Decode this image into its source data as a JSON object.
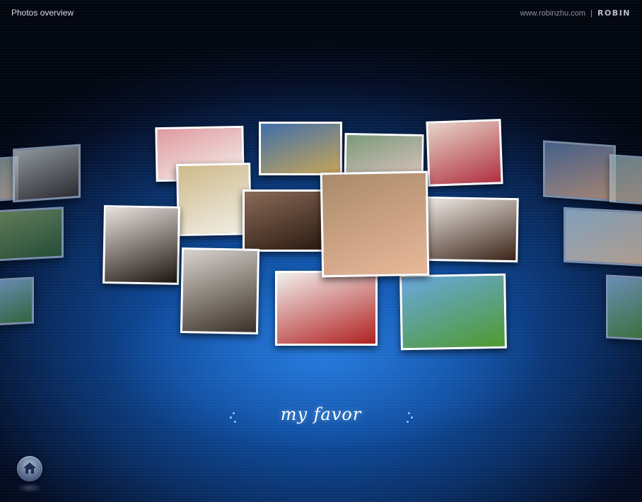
{
  "header": {
    "title": "Photos overview",
    "site_url": "www.robinzhu.com",
    "separator": "|",
    "logo_text": "ROBIN"
  },
  "gallery": {
    "caption": "my favor",
    "photos": [
      {
        "name": "photo-left-woman-edge",
        "subject": "woman portrait",
        "colors": [
          "#8fa3a3",
          "#c9b8a8"
        ]
      },
      {
        "name": "photo-left-woman",
        "subject": "woman portrait",
        "colors": [
          "#bcc7c9",
          "#3a302c"
        ]
      },
      {
        "name": "photo-left-leaves",
        "subject": "green leaves",
        "colors": [
          "#7fa06a",
          "#2f5a2e"
        ]
      },
      {
        "name": "photo-left-tree",
        "subject": "tree on hill",
        "colors": [
          "#8ab0d6",
          "#3f7a3a"
        ]
      },
      {
        "name": "photo-dog-bubble",
        "subject": "dog with bubble",
        "colors": [
          "#e09aa0",
          "#f4f0ec"
        ]
      },
      {
        "name": "photo-sky-field",
        "subject": "sky and field",
        "colors": [
          "#3f6fa8",
          "#c8a55a"
        ]
      },
      {
        "name": "photo-bubblegum-girl",
        "subject": "girl blowing bubble",
        "colors": [
          "#7a9a7a",
          "#e8c8c8"
        ]
      },
      {
        "name": "photo-woman-red-top",
        "subject": "woman portrait",
        "colors": [
          "#e6d3c8",
          "#b03040"
        ]
      },
      {
        "name": "photo-puppy",
        "subject": "bulldog puppy",
        "colors": [
          "#cdb98a",
          "#f3efe6"
        ]
      },
      {
        "name": "photo-curly-hair-woman",
        "subject": "woman with curly hair",
        "colors": [
          "#8a6b58",
          "#2a1a12"
        ]
      },
      {
        "name": "photo-smiling-woman-large",
        "subject": "smiling woman",
        "colors": [
          "#a98a6a",
          "#e8b89a"
        ]
      },
      {
        "name": "photo-brunette-woman",
        "subject": "woman portrait",
        "colors": [
          "#f2ece8",
          "#3a2418"
        ]
      },
      {
        "name": "photo-asian-woman-smile",
        "subject": "smiling woman",
        "colors": [
          "#e9e3df",
          "#1c1410"
        ]
      },
      {
        "name": "photo-young-man",
        "subject": "young man",
        "colors": [
          "#d8d4ce",
          "#3a3028"
        ]
      },
      {
        "name": "photo-fashion-woman",
        "subject": "fashion portrait",
        "colors": [
          "#f2f0ee",
          "#b02020"
        ]
      },
      {
        "name": "photo-green-hill-tree",
        "subject": "tree on green hill",
        "colors": [
          "#6aa8e0",
          "#4f9a2e"
        ]
      },
      {
        "name": "photo-right-couple",
        "subject": "couple",
        "colors": [
          "#5a7aa8",
          "#d8a888"
        ]
      },
      {
        "name": "photo-right-edge",
        "subject": "portrait",
        "colors": [
          "#8aa8b0",
          "#c8b098"
        ]
      },
      {
        "name": "photo-right-cartoon",
        "subject": "cartoon character",
        "colors": [
          "#a8c8e0",
          "#e8c8a8"
        ]
      },
      {
        "name": "photo-right-tree",
        "subject": "tree on hill",
        "colors": [
          "#8ab0d6",
          "#4f8a3a"
        ]
      }
    ]
  },
  "home_button": {
    "icon": "home-icon"
  }
}
